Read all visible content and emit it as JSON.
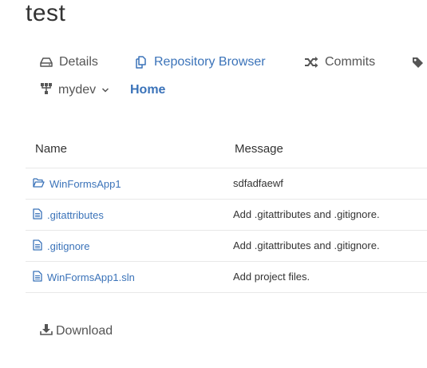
{
  "repo": {
    "title": "test"
  },
  "tabs": [
    {
      "label": "Details",
      "icon": "hdd-icon",
      "active": false
    },
    {
      "label": "Repository Browser",
      "icon": "copy-icon",
      "active": true
    },
    {
      "label": "Commits",
      "icon": "shuffle-icon",
      "active": false
    },
    {
      "label": "",
      "icon": "tag-icon",
      "active": false
    }
  ],
  "branch": {
    "name": "mydev",
    "breadcrumb_home": "Home"
  },
  "table": {
    "headers": {
      "name": "Name",
      "message": "Message"
    },
    "rows": [
      {
        "type": "folder",
        "name": "WinFormsApp1",
        "message": "sdfadfaewf"
      },
      {
        "type": "file",
        "name": ".gitattributes",
        "message": "Add .gitattributes and .gitignore."
      },
      {
        "type": "file",
        "name": ".gitignore",
        "message": "Add .gitattributes and .gitignore."
      },
      {
        "type": "file",
        "name": "WinFormsApp1.sln",
        "message": "Add project files."
      }
    ]
  },
  "download": {
    "label": "Download"
  },
  "colors": {
    "link": "#3b73b9",
    "text": "#555555",
    "border": "#e8e8e8"
  }
}
